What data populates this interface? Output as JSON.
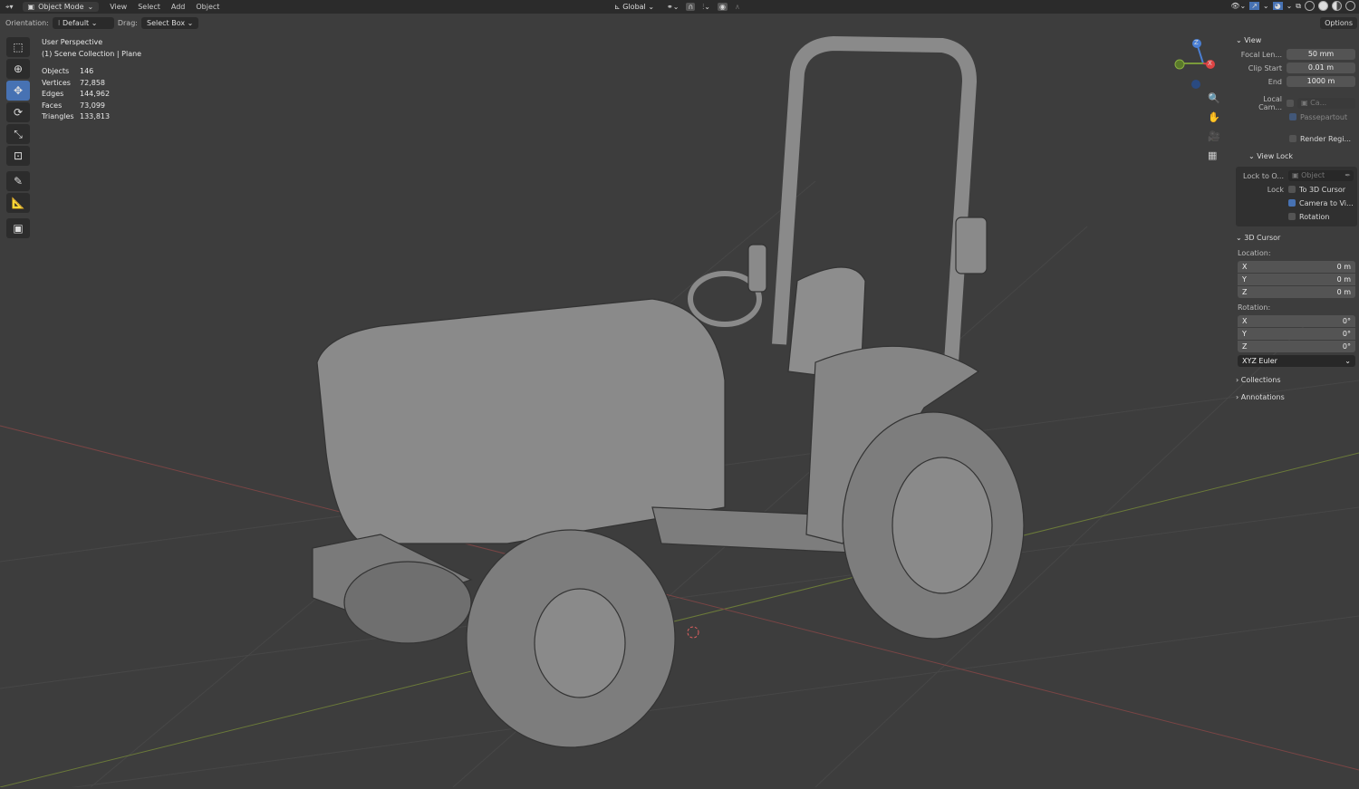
{
  "header": {
    "mode": "Object Mode",
    "menus": [
      "View",
      "Select",
      "Add",
      "Object"
    ],
    "orientation_label": "Orientation:",
    "orientation": "Default",
    "drag_label": "Drag:",
    "drag": "Select Box",
    "transform_space": "Global",
    "options": "Options"
  },
  "overlay": {
    "view_name": "User Perspective",
    "collection": "(1) Scene Collection | Plane",
    "stats": [
      {
        "label": "Objects",
        "value": "146"
      },
      {
        "label": "Vertices",
        "value": "72,858"
      },
      {
        "label": "Edges",
        "value": "144,962"
      },
      {
        "label": "Faces",
        "value": "73,099"
      },
      {
        "label": "Triangles",
        "value": "133,813"
      }
    ]
  },
  "gizmo": {
    "z": "Z",
    "x": "X"
  },
  "sidebar": {
    "view": {
      "title": "View",
      "focal_label": "Focal Len...",
      "focal": "50 mm",
      "clip_start_label": "Clip Start",
      "clip_start": "0.01 m",
      "end_label": "End",
      "end": "1000 m",
      "local_cam_label": "Local Cam...",
      "local_cam": "Ca...",
      "passepartout": "Passepartout",
      "render_region": "Render Regi..."
    },
    "view_lock": {
      "title": "View Lock",
      "lock_to_label": "Lock to O...",
      "lock_to": "Object",
      "lock_label": "Lock",
      "to_cursor": "To 3D Cursor",
      "camera_to_view": "Camera to Vi...",
      "rotation": "Rotation"
    },
    "cursor": {
      "title": "3D Cursor",
      "location_label": "Location:",
      "loc": [
        {
          "axis": "X",
          "value": "0 m"
        },
        {
          "axis": "Y",
          "value": "0 m"
        },
        {
          "axis": "Z",
          "value": "0 m"
        }
      ],
      "rotation_label": "Rotation:",
      "rot": [
        {
          "axis": "X",
          "value": "0°"
        },
        {
          "axis": "Y",
          "value": "0°"
        },
        {
          "axis": "Z",
          "value": "0°"
        }
      ],
      "rotation_mode": "XYZ Euler"
    },
    "collections": "Collections",
    "annotations": "Annotations"
  }
}
